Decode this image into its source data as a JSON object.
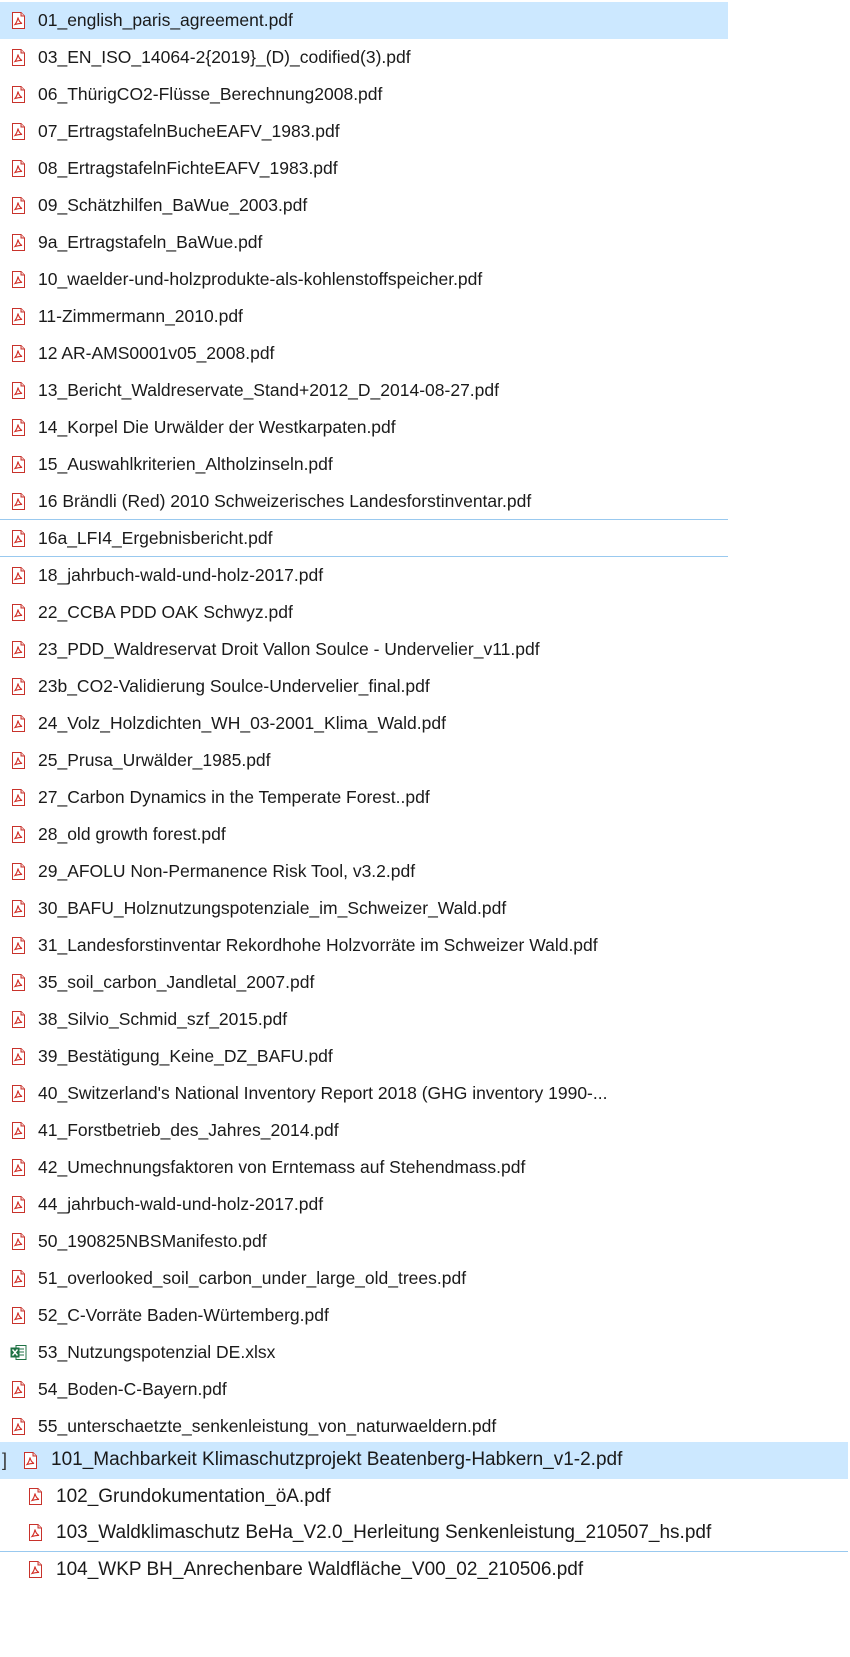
{
  "colors": {
    "selection_bg": "#cce8ff",
    "focus_line": "#99c9ef",
    "pdf_icon_red": "#d22f27",
    "xlsx_icon_green": "#1f7244"
  },
  "files": [
    {
      "name": "01_english_paris_agreement.pdf",
      "icon": "pdf-icon",
      "selected": true
    },
    {
      "name": "03_EN_ISO_14064-2{2019}_(D)_codified(3).pdf",
      "icon": "pdf-icon"
    },
    {
      "name": "06_ThürigCO2-Flüsse_Berechnung2008.pdf",
      "icon": "pdf-icon"
    },
    {
      "name": "07_ErtragstafelnBucheEAFV_1983.pdf",
      "icon": "pdf-icon"
    },
    {
      "name": "08_ErtragstafelnFichteEAFV_1983.pdf",
      "icon": "pdf-icon"
    },
    {
      "name": "09_Schätzhilfen_BaWue_2003.pdf",
      "icon": "pdf-icon"
    },
    {
      "name": "9a_Ertragstafeln_BaWue.pdf",
      "icon": "pdf-icon"
    },
    {
      "name": "10_waelder-und-holzprodukte-als-kohlenstoffspeicher.pdf",
      "icon": "pdf-icon"
    },
    {
      "name": "11-Zimmermann_2010.pdf",
      "icon": "pdf-icon"
    },
    {
      "name": "12 AR-AMS0001v05_2008.pdf",
      "icon": "pdf-icon"
    },
    {
      "name": "13_Bericht_Waldreservate_Stand+2012_D_2014-08-27.pdf",
      "icon": "pdf-icon"
    },
    {
      "name": "14_Korpel Die  Urwälder  der  Westkarpaten.pdf",
      "icon": "pdf-icon"
    },
    {
      "name": "15_Auswahlkriterien_Altholzinseln.pdf",
      "icon": "pdf-icon"
    },
    {
      "name": "16 Brändli (Red) 2010 Schweizerisches Landesforstinventar.pdf",
      "icon": "pdf-icon",
      "focus_line": true
    },
    {
      "name": "16a_LFI4_Ergebnisbericht.pdf",
      "icon": "pdf-icon",
      "focus_line": true
    },
    {
      "name": "18_jahrbuch-wald-und-holz-2017.pdf",
      "icon": "pdf-icon"
    },
    {
      "name": "22_CCBA PDD OAK Schwyz.pdf",
      "icon": "pdf-icon"
    },
    {
      "name": "23_PDD_Waldreservat Droit Vallon Soulce - Undervelier_v11.pdf",
      "icon": "pdf-icon"
    },
    {
      "name": "23b_CO2-Validierung Soulce-Undervelier_final.pdf",
      "icon": "pdf-icon"
    },
    {
      "name": "24_Volz_Holzdichten_WH_03-2001_Klima_Wald.pdf",
      "icon": "pdf-icon"
    },
    {
      "name": "25_Prusa_Urwälder_1985.pdf",
      "icon": "pdf-icon"
    },
    {
      "name": "27_Carbon Dynamics in the Temperate Forest..pdf",
      "icon": "pdf-icon"
    },
    {
      "name": "28_old growth forest.pdf",
      "icon": "pdf-icon"
    },
    {
      "name": "29_AFOLU Non-Permanence Risk Tool, v3.2.pdf",
      "icon": "pdf-icon"
    },
    {
      "name": "30_BAFU_Holznutzungspotenziale_im_Schweizer_Wald.pdf",
      "icon": "pdf-icon"
    },
    {
      "name": "31_Landesforstinventar  Rekordhohe Holzvorräte im Schweizer Wald.pdf",
      "icon": "pdf-icon"
    },
    {
      "name": "35_soil_carbon_Jandletal_2007.pdf",
      "icon": "pdf-icon"
    },
    {
      "name": "38_Silvio_Schmid_szf_2015.pdf",
      "icon": "pdf-icon"
    },
    {
      "name": "39_Bestätigung_Keine_DZ_BAFU.pdf",
      "icon": "pdf-icon"
    },
    {
      "name": "40_Switzerland's National Inventory Report 2018 (GHG inventory 1990-...",
      "icon": "pdf-icon"
    },
    {
      "name": "41_Forstbetrieb_des_Jahres_2014.pdf",
      "icon": "pdf-icon"
    },
    {
      "name": "42_Umechnungsfaktoren von Erntemass auf Stehendmass.pdf",
      "icon": "pdf-icon"
    },
    {
      "name": "44_jahrbuch-wald-und-holz-2017.pdf",
      "icon": "pdf-icon"
    },
    {
      "name": "50_190825NBSManifesto.pdf",
      "icon": "pdf-icon"
    },
    {
      "name": "51_overlooked_soil_carbon_under_large_old_trees.pdf",
      "icon": "pdf-icon"
    },
    {
      "name": "52_C-Vorräte Baden-Würtemberg.pdf",
      "icon": "pdf-icon"
    },
    {
      "name": "53_Nutzungspotenzial DE.xlsx",
      "icon": "xlsx-icon"
    },
    {
      "name": "54_Boden-C-Bayern.pdf",
      "icon": "pdf-icon"
    },
    {
      "name": "55_unterschaetzte_senkenleistung_von_naturwaeldern.pdf",
      "icon": "pdf-icon"
    }
  ],
  "files_second": [
    {
      "name": "101_Machbarkeit Klimaschutzprojekt Beatenberg-Habkern_v1-2.pdf",
      "icon": "pdf-icon",
      "selected": true,
      "bracket": "]"
    },
    {
      "name": "102_Grundokumentation_öA.pdf",
      "icon": "pdf-icon"
    },
    {
      "name": "103_Waldklimaschutz BeHa_V2.0_Herleitung Senkenleistung_210507_hs.pdf",
      "icon": "pdf-icon",
      "focus_line": true
    },
    {
      "name": "104_WKP BH_Anrechenbare Waldfläche_V00_02_210506.pdf",
      "icon": "pdf-icon"
    }
  ]
}
